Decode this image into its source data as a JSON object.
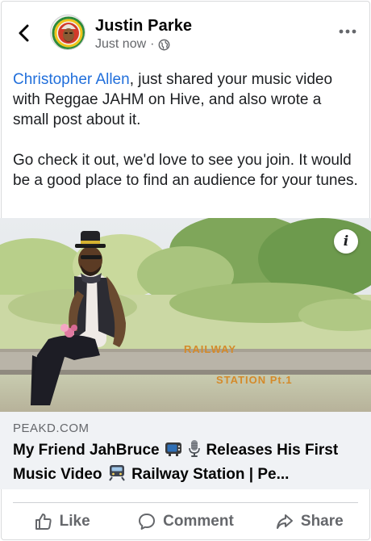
{
  "post": {
    "author": "Justin Parke",
    "timestamp": "Just now",
    "separator": "·",
    "privacy_icon": "globe-icon",
    "mention": "Christopher Allen",
    "body_line1_rest": ", just shared your music video with Reggae JAHM on Hive, and also wrote a small post about it.",
    "body_paragraph2": "Go check it out, we'd love to see you join. It would be a good place to find an audience for your tunes."
  },
  "media": {
    "sign_line1": "RAILWAY",
    "sign_line2": "STATION Pt.1",
    "info_label": "i"
  },
  "link_preview": {
    "domain": "PEAKD.COM",
    "title_part1": "My Friend JahBruce",
    "title_part2": "Releases His First Music Video",
    "title_part3": "Railway Station | Pe..."
  },
  "actions": {
    "like": "Like",
    "comment": "Comment",
    "share": "Share"
  },
  "colors": {
    "mention": "#216fdb",
    "secondary_text": "#65676b",
    "link_box_bg": "#f0f2f5"
  }
}
